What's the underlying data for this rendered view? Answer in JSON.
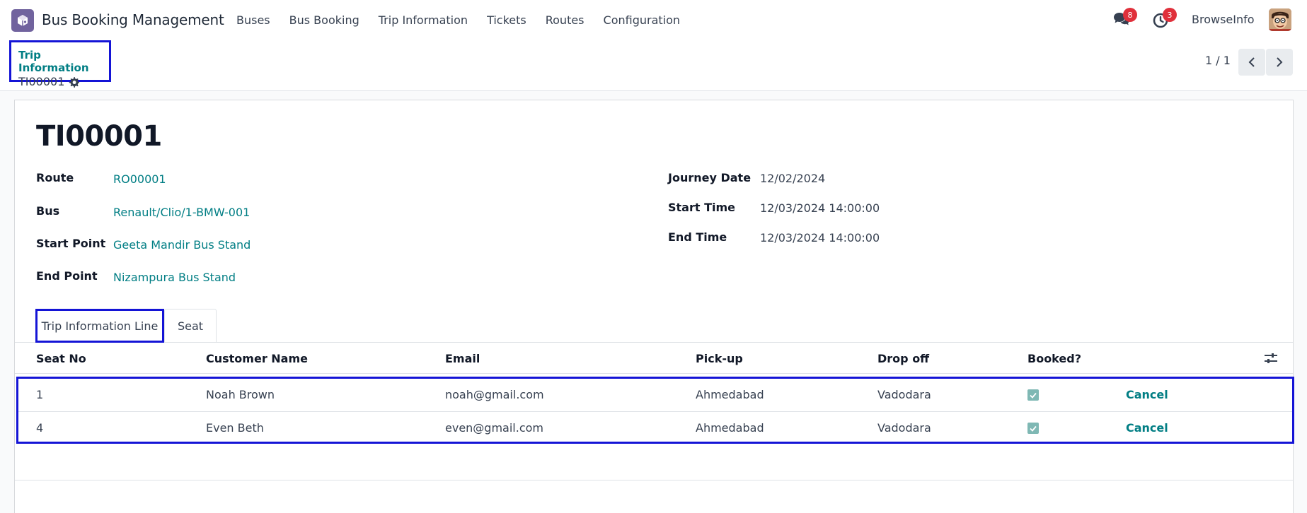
{
  "navbar": {
    "app_icon": "bus-booking-app-icon",
    "app_title": "Bus Booking Management",
    "menu": [
      {
        "label": "Buses"
      },
      {
        "label": "Bus Booking"
      },
      {
        "label": "Trip Information"
      },
      {
        "label": "Tickets"
      },
      {
        "label": "Routes"
      },
      {
        "label": "Configuration"
      }
    ],
    "messages_badge": "8",
    "activities_badge": "3",
    "user_name": "BrowseInfo"
  },
  "control_panel": {
    "breadcrumb": "Trip Information",
    "record_name": "TI00001",
    "pager_value": "1 / 1"
  },
  "form": {
    "title": "TI00001",
    "left_fields": [
      {
        "label": "Route",
        "value": "RO00001"
      },
      {
        "label": "Bus",
        "value": "Renault/Clio/1-BMW-001"
      },
      {
        "label": "Start Point",
        "value": "Geeta Mandir Bus Stand"
      },
      {
        "label": "End Point",
        "value": "Nizampura Bus Stand"
      }
    ],
    "right_fields": [
      {
        "label": "Journey Date",
        "value": "12/02/2024"
      },
      {
        "label": "Start Time",
        "value": "12/03/2024 14:00:00"
      },
      {
        "label": "End Time",
        "value": "12/03/2024 14:00:00"
      }
    ]
  },
  "tabs": [
    {
      "label": "Trip Information Line",
      "active": true
    },
    {
      "label": "Seat",
      "active": false
    }
  ],
  "table": {
    "columns": [
      "Seat No",
      "Customer Name",
      "Email",
      "Pick-up",
      "Drop off",
      "Booked?"
    ],
    "rows": [
      {
        "seat_no": "1",
        "customer": "Noah Brown",
        "email": "noah@gmail.com",
        "pickup": "Ahmedabad",
        "dropoff": "Vadodara",
        "booked": true,
        "action": "Cancel"
      },
      {
        "seat_no": "4",
        "customer": "Even Beth",
        "email": "even@gmail.com",
        "pickup": "Ahmedabad",
        "dropoff": "Vadodara",
        "booked": true,
        "action": "Cancel"
      }
    ]
  },
  "colors": {
    "accent": "#017e84",
    "highlight_border": "#1414d6",
    "badge": "#e0303b",
    "app_icon_bg": "#71639e"
  }
}
